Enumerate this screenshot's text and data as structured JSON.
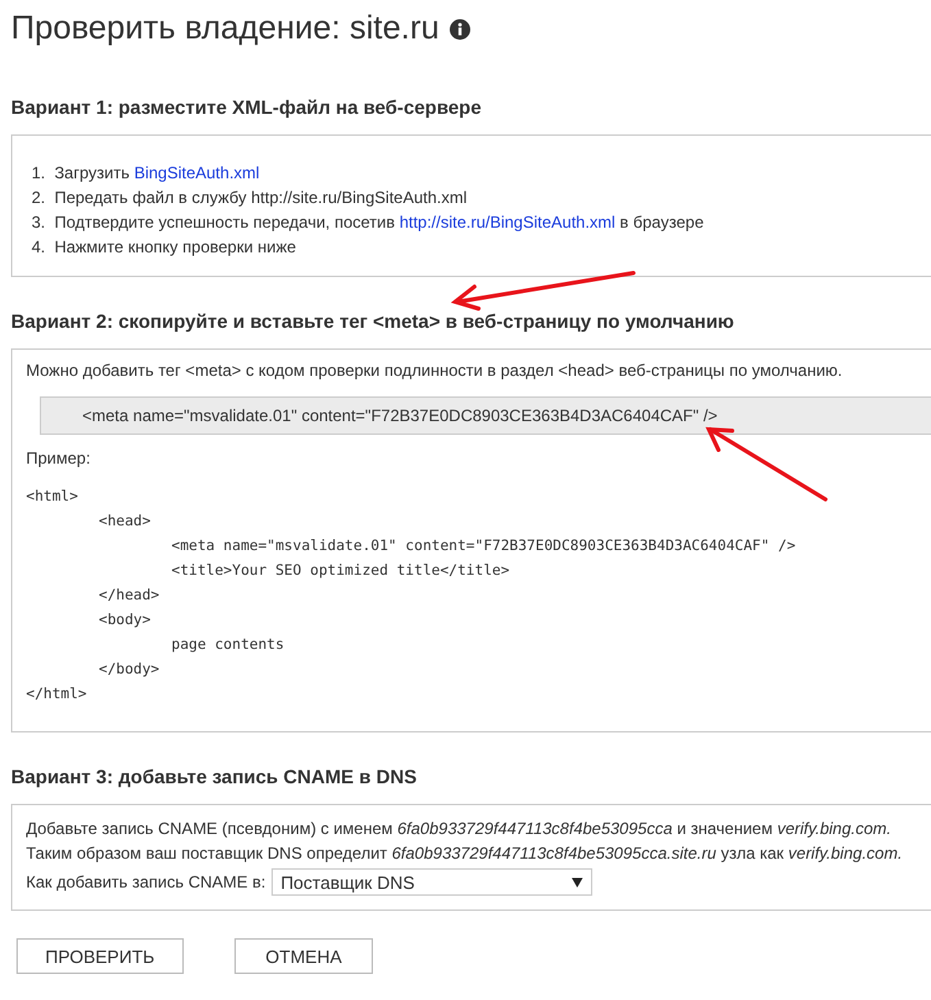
{
  "title": "Проверить владение: site.ru",
  "sections": [
    {
      "heading": "Вариант 1: разместите XML-файл на веб-сервере",
      "kind": "steps",
      "steps": [
        {
          "number": "1.",
          "parts": [
            {
              "kind": "text",
              "text": "Загрузить "
            },
            {
              "kind": "link",
              "text": "BingSiteAuth.xml"
            }
          ]
        },
        {
          "number": "2.",
          "parts": [
            {
              "kind": "text",
              "text": "Передать файл в службу http://site.ru/BingSiteAuth.xml"
            }
          ]
        },
        {
          "number": "3.",
          "parts": [
            {
              "kind": "text",
              "text": "Подтвердите успешность передачи, посетив "
            },
            {
              "kind": "link",
              "text": "http://site.ru/BingSiteAuth.xml"
            },
            {
              "kind": "text",
              "text": " в браузере"
            }
          ]
        },
        {
          "number": "4.",
          "parts": [
            {
              "kind": "text",
              "text": "Нажмите кнопку проверки ниже"
            }
          ]
        }
      ]
    },
    {
      "heading": "Вариант 2: скопируйте и вставьте тег <meta> в веб-страницу по умолчанию",
      "kind": "meta",
      "intro": "Можно добавить тег <meta> с кодом проверки подлинности в раздел <head> веб-страницы по умолчанию.",
      "tag": "<meta name=\"msvalidate.01\" content=\"F72B37E0DC8903CE363B4D3AC6404CAF\" />",
      "example_label": "Пример:",
      "code": [
        {
          "text": "<html>",
          "children": [
            {
              "text": "<head>",
              "children": [
                {
                  "text": "<meta name=\"msvalidate.01\" content=\"F72B37E0DC8903CE363B4D3AC6404CAF\" />"
                },
                {
                  "text": "<title>Your SEO optimized title</title>"
                }
              ]
            },
            {
              "text": "</head>"
            },
            {
              "text": "<body>",
              "children": [
                {
                  "text": "page contents"
                }
              ]
            },
            {
              "text": "</body>"
            }
          ]
        },
        {
          "text": "</html>"
        }
      ]
    },
    {
      "heading": "Вариант 3: добавьте запись CNAME в DNS",
      "kind": "cname",
      "paragraphs": [
        "Добавьте запись CNAME (псевдоним) с именем *6fa0b933729f447113c8f4be53095cca* и значением *verify.bing.com.*",
        "Таким образом ваш поставщик DNS определит *6fa0b933729f447113c8f4be53095cca.site.ru* узла как *verify.bing.com.*"
      ],
      "select_label": "Как добавить запись CNAME в:",
      "select_value": "Поставщик DNS"
    }
  ],
  "buttons": [
    "ПРОВЕРИТЬ",
    "ОТМЕНА"
  ]
}
